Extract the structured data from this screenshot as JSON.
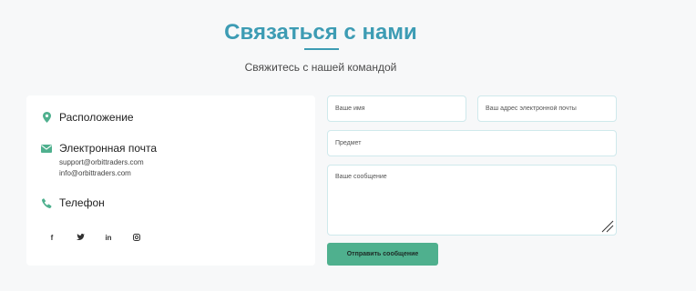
{
  "header": {
    "title": "Связаться с нами",
    "subtitle": "Свяжитесь с нашей командой"
  },
  "contact_info": {
    "location_label": "Расположение",
    "email_label": "Электронная почта",
    "emails": [
      "support@orbittraders.com",
      "info@orbittraders.com"
    ],
    "phone_label": "Телефон",
    "socials": [
      {
        "icon": "facebook-icon",
        "glyph": "f"
      },
      {
        "icon": "twitter-icon",
        "glyph": "t"
      },
      {
        "icon": "linkedin-icon",
        "glyph": "in"
      },
      {
        "icon": "instagram-icon",
        "glyph": "◎"
      }
    ]
  },
  "form": {
    "name_placeholder": "Ваше имя",
    "email_placeholder": "Ваш адрес электронной почты",
    "subject_placeholder": "Предмет",
    "message_placeholder": "Ваше сообщение",
    "submit_label": "Отправить сообщение"
  },
  "colors": {
    "accent": "#3d9cb4",
    "icon_green": "#4fb08e",
    "button": "#4fb08e"
  }
}
